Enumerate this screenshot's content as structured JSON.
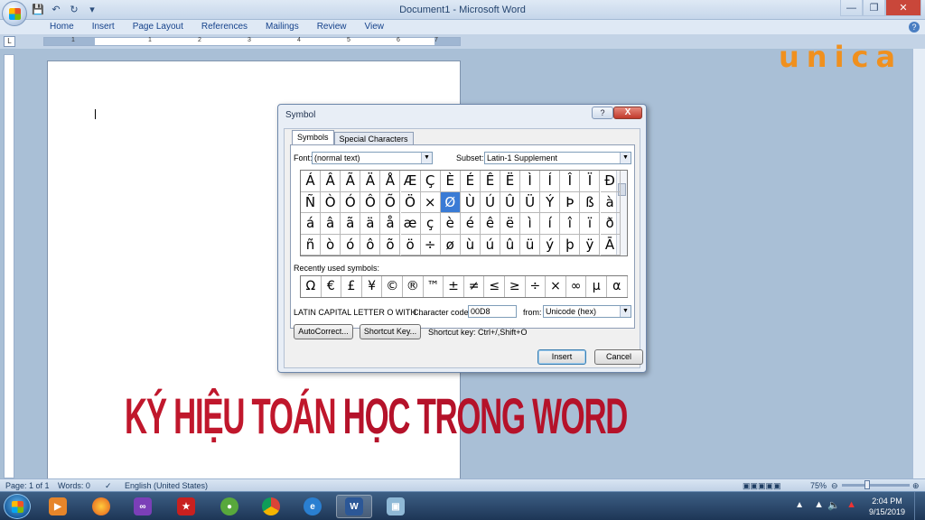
{
  "window": {
    "title": "Document1 - Microsoft Word"
  },
  "ribbon": {
    "tabs": [
      "Home",
      "Insert",
      "Page Layout",
      "References",
      "Mailings",
      "Review",
      "View"
    ]
  },
  "ruler": {
    "numbers": [
      "1",
      "1",
      "2",
      "3",
      "4",
      "5",
      "6",
      "7"
    ]
  },
  "logo": {
    "text": "unica"
  },
  "dialog": {
    "title": "Symbol",
    "help_label": "?",
    "close_label": "X",
    "tabs": [
      "Symbols",
      "Special Characters"
    ],
    "font_label": "Font:",
    "font_value": "(normal text)",
    "subset_label": "Subset:",
    "subset_value": "Latin-1 Supplement",
    "symbols": [
      [
        "Á",
        "Â",
        "Ã",
        "Ä",
        "Å",
        "Æ",
        "Ç",
        "È",
        "É",
        "Ê",
        "Ë",
        "Ì",
        "Í",
        "Î",
        "Ï",
        "Ð"
      ],
      [
        "Ñ",
        "Ò",
        "Ó",
        "Ô",
        "Õ",
        "Ö",
        "×",
        "Ø",
        "Ù",
        "Ú",
        "Û",
        "Ü",
        "Ý",
        "Þ",
        "ß",
        "à"
      ],
      [
        "á",
        "â",
        "ã",
        "ä",
        "å",
        "æ",
        "ç",
        "è",
        "é",
        "ê",
        "ë",
        "ì",
        "í",
        "î",
        "ï",
        "ð"
      ],
      [
        "ñ",
        "ò",
        "ó",
        "ô",
        "õ",
        "ö",
        "÷",
        "ø",
        "ù",
        "ú",
        "û",
        "ü",
        "ý",
        "þ",
        "ÿ",
        "Ā"
      ]
    ],
    "selected": {
      "row": 1,
      "col": 7
    },
    "recent_label": "Recently used symbols:",
    "recent": [
      "Ω",
      "€",
      "£",
      "¥",
      "©",
      "®",
      "™",
      "±",
      "≠",
      "≤",
      "≥",
      "÷",
      "×",
      "∞",
      "µ",
      "α"
    ],
    "char_name": "LATIN CAPITAL LETTER O WITH ...",
    "char_code_label": "Character code:",
    "char_code": "00D8",
    "from_label": "from:",
    "from_value": "Unicode (hex)",
    "autocorrect_label": "AutoCorrect...",
    "shortcut_key_label": "Shortcut Key...",
    "shortcut_text": "Shortcut key: Ctrl+/,Shift+O",
    "insert_label": "Insert",
    "cancel_label": "Cancel"
  },
  "overlay": {
    "part1": "KÝ HIỆU TOÁN ",
    "part2": "HỌC TRONG WORD"
  },
  "statusbar": {
    "page": "Page: 1 of 1",
    "words": "Words: 0",
    "language": "English (United States)",
    "zoom": "75%"
  },
  "taskbar": {
    "time": "2:04 PM",
    "date": "9/15/2019"
  }
}
